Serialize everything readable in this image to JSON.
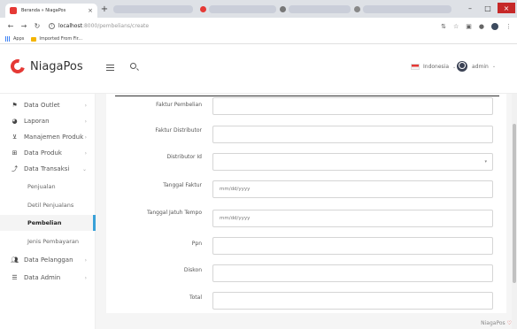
{
  "browser": {
    "tab_title": "Beranda » NiagaPos",
    "tab_close": "×",
    "new_tab": "+",
    "url_host": "localhost",
    "url_path": ":8000/pembelians/create",
    "bookmarks": [
      {
        "label": "Apps"
      },
      {
        "label": "Imported From Fir..."
      }
    ]
  },
  "header": {
    "logo_text": "NiagaPos",
    "language": "Indonesia",
    "user": "admin"
  },
  "sidebar": {
    "items": [
      {
        "label": "Data Outlet",
        "icon": "flag-icon",
        "has_arrow": true
      },
      {
        "label": "Laporan",
        "icon": "chart-pie-icon",
        "has_arrow": true
      },
      {
        "label": "Manajemen Produk",
        "icon": "cart-icon",
        "has_arrow": true
      },
      {
        "label": "Data Produk",
        "icon": "gift-icon",
        "has_arrow": true
      },
      {
        "label": "Data Transaksi",
        "icon": "line-chart-icon",
        "has_arrow": true,
        "expanded": true
      }
    ],
    "sub_items": [
      {
        "label": "Penjualan",
        "active": false
      },
      {
        "label": "Detil Penjualans",
        "active": false
      },
      {
        "label": "Pembelian",
        "active": true
      },
      {
        "label": "Jenis Pembayaran",
        "active": false
      }
    ],
    "bottom_items": [
      {
        "label": "Data Pelanggan",
        "icon": "users-icon",
        "has_arrow": true
      },
      {
        "label": "Data Admin",
        "icon": "list-icon",
        "has_arrow": true
      }
    ]
  },
  "form": {
    "fields": [
      {
        "label": "Faktur Pembelian",
        "type": "text",
        "value": "",
        "placeholder": ""
      },
      {
        "label": "Faktur Distributor",
        "type": "text",
        "value": "",
        "placeholder": ""
      },
      {
        "label": "Distributor Id",
        "type": "select",
        "value": "",
        "placeholder": ""
      },
      {
        "label": "Tanggal Faktur",
        "type": "date",
        "value": "",
        "placeholder": "mm/dd/yyyy"
      },
      {
        "label": "Tanggal Jatuh Tempo",
        "type": "date",
        "value": "",
        "placeholder": "mm/dd/yyyy"
      },
      {
        "label": "Ppn",
        "type": "text",
        "value": "",
        "placeholder": ""
      },
      {
        "label": "Diskon",
        "type": "text",
        "value": "",
        "placeholder": ""
      },
      {
        "label": "Total",
        "type": "text",
        "value": "",
        "placeholder": ""
      }
    ]
  },
  "footer": {
    "brand": "NiagaPos",
    "heart": "♡"
  },
  "colors": {
    "accent": "#e53935",
    "active_marker": "#39a1d8"
  }
}
